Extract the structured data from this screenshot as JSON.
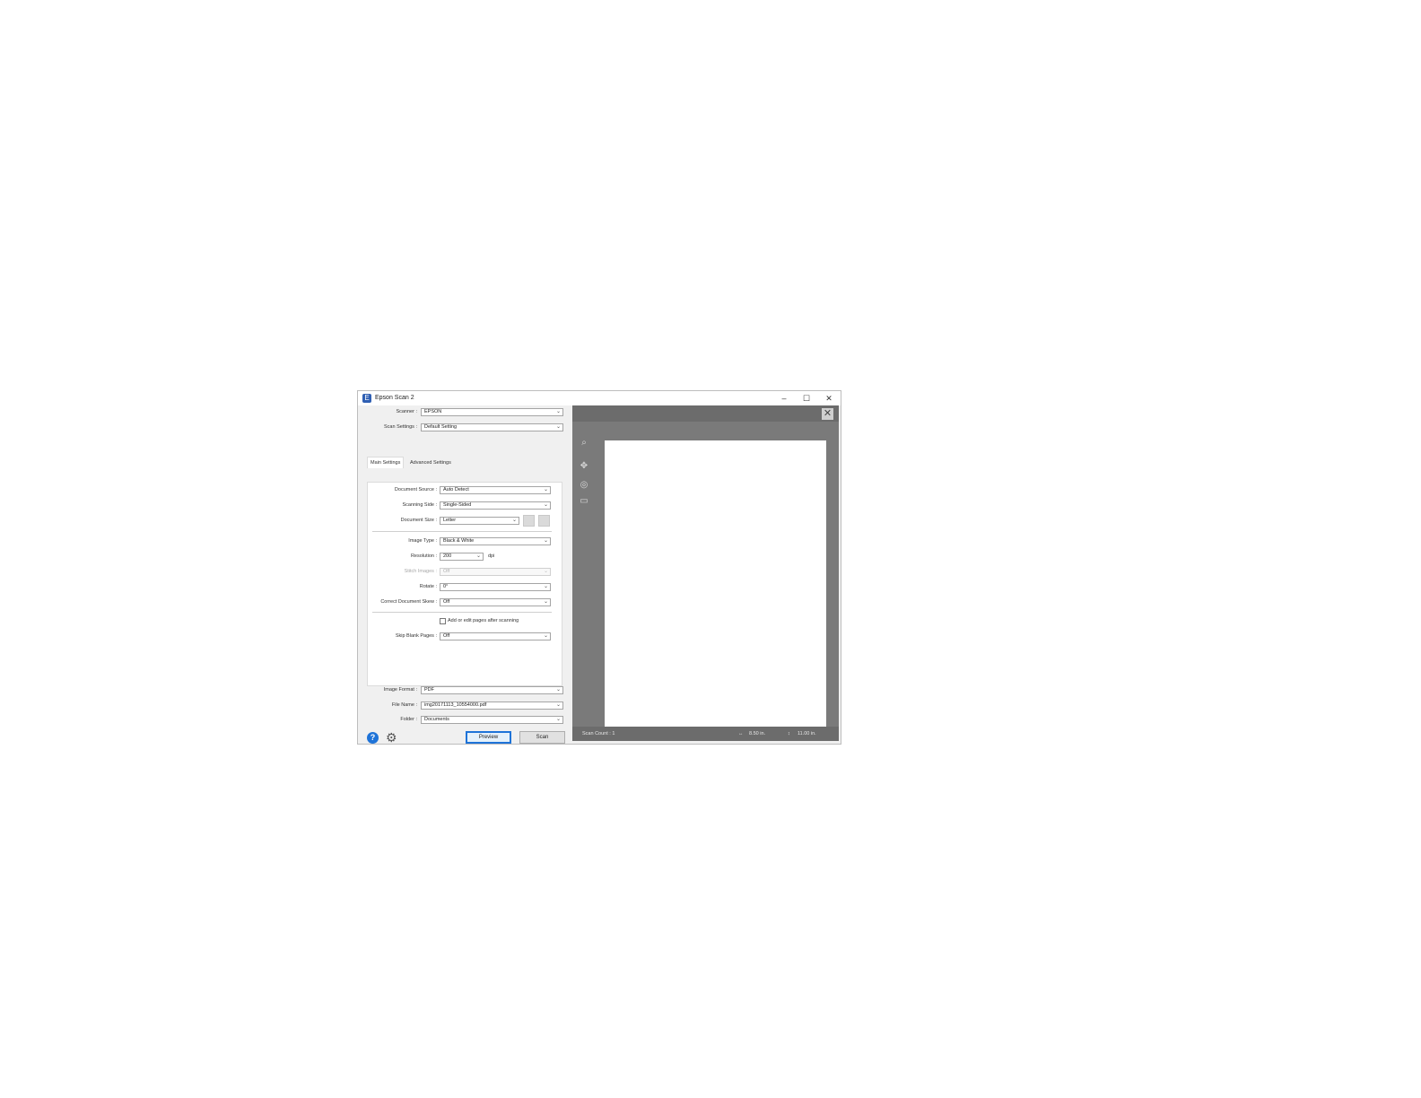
{
  "window": {
    "title": "Epson Scan 2",
    "minimize": "–",
    "maximize": "☐",
    "close": "✕"
  },
  "top_settings": {
    "scanner_label": "Scanner :",
    "scanner_value": "EPSON",
    "scan_settings_label": "Scan Settings :",
    "scan_settings_value": "Default Setting"
  },
  "tabs": {
    "main": "Main Settings",
    "advanced": "Advanced Settings"
  },
  "main_settings": {
    "document_source_label": "Document Source :",
    "document_source_value": "Auto Detect",
    "scanning_side_label": "Scanning Side :",
    "scanning_side_value": "Single-Sided",
    "document_size_label": "Document Size :",
    "document_size_value": "Letter",
    "image_type_label": "Image Type :",
    "image_type_value": "Black & White",
    "resolution_label": "Resolution :",
    "resolution_value": "200",
    "resolution_unit": "dpi",
    "stitch_images_label": "Stitch Images :",
    "stitch_images_value": "Off",
    "rotate_label": "Rotate :",
    "rotate_value": "0°",
    "correct_skew_label": "Correct Document Skew :",
    "correct_skew_value": "Off",
    "add_edit_pages_label": "Add or edit pages after scanning",
    "skip_blank_label": "Skip Blank Pages :",
    "skip_blank_value": "Off"
  },
  "output": {
    "image_format_label": "Image Format :",
    "image_format_value": "PDF",
    "file_name_label": "File Name :",
    "file_name_value": "img20171113_10554000.pdf",
    "folder_label": "Folder :",
    "folder_value": "Documents"
  },
  "buttons": {
    "preview": "Preview",
    "scan": "Scan"
  },
  "preview": {
    "close": "✕",
    "scan_count": "Scan Count : 1",
    "width": "8.50 in.",
    "height": "11.00 in."
  },
  "icons": {
    "help": "?",
    "gear": "⚙",
    "zoom": "⌕",
    "rotate_view": "✥",
    "crop": "◎",
    "frame": "▭",
    "width_icon": "↔",
    "height_icon": "↕"
  }
}
